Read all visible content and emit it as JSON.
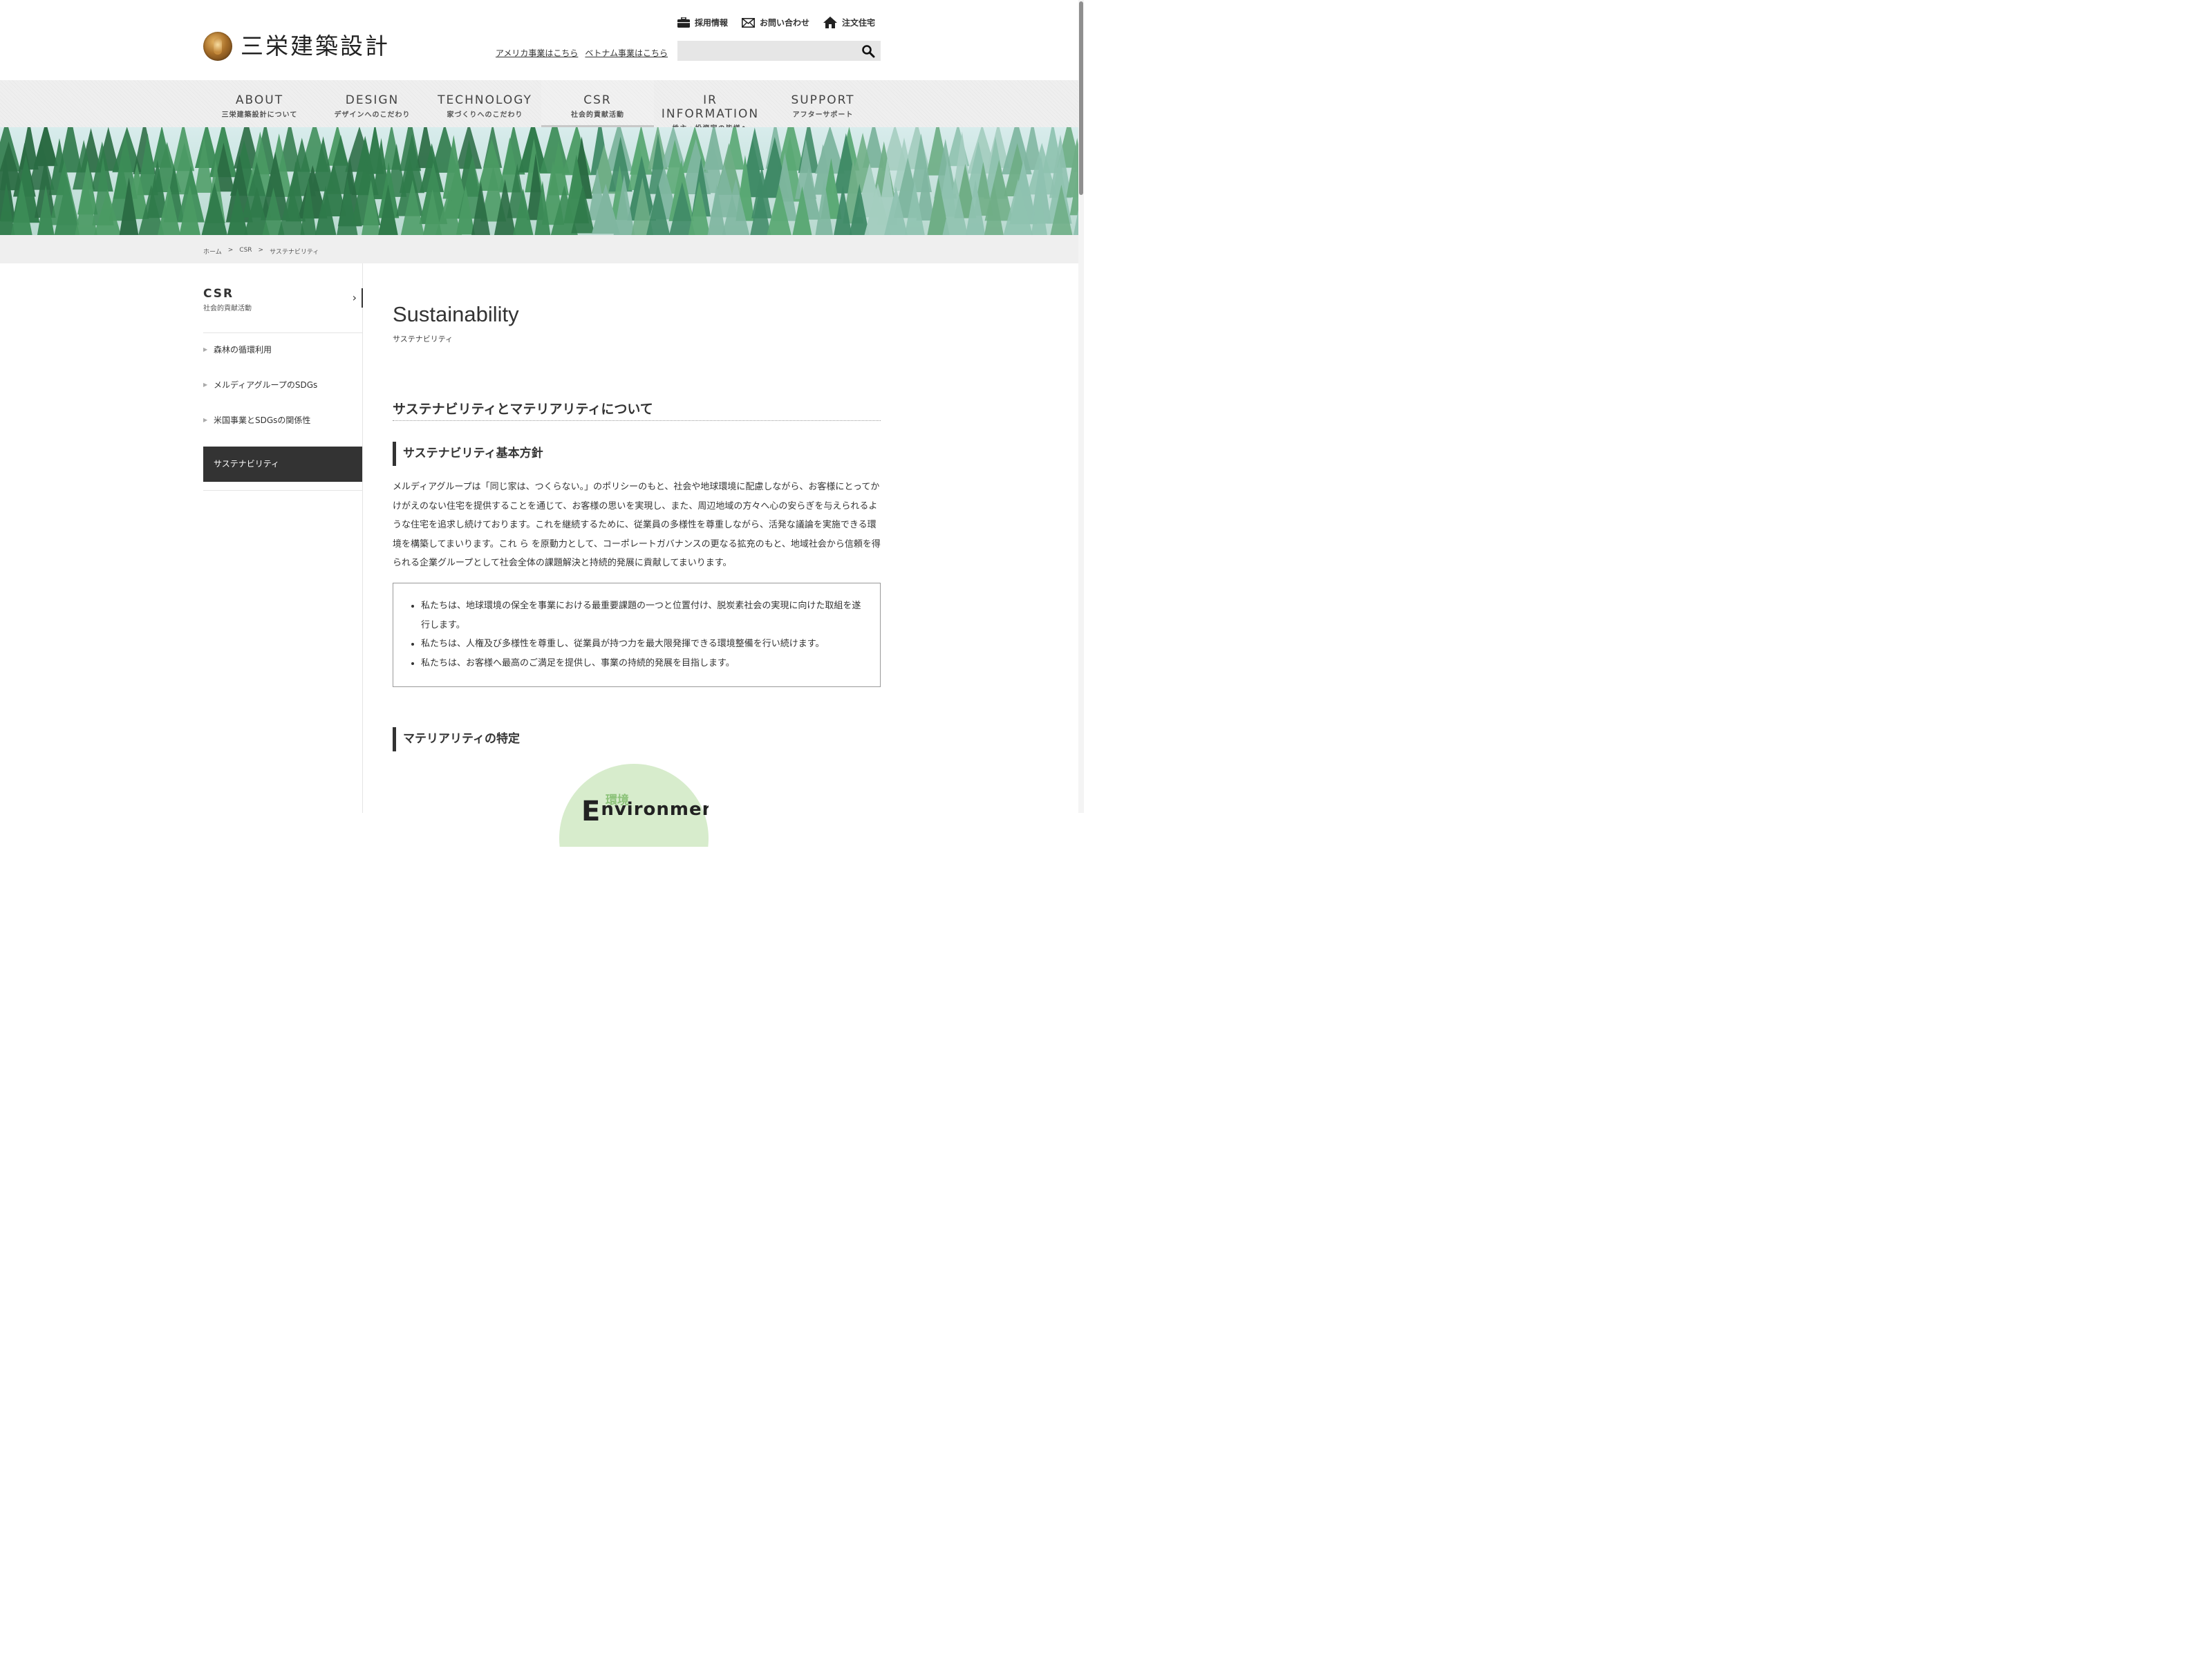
{
  "header": {
    "logo_text": "三栄建築設計",
    "util_links": [
      {
        "icon": "briefcase-icon",
        "label": "採用情報"
      },
      {
        "icon": "envelope-icon",
        "label": "お問い合わせ"
      },
      {
        "icon": "house-icon",
        "label": "注文住宅"
      }
    ],
    "sub_links": [
      "アメリカ事業はこちら",
      "ベトナム事業はこちら"
    ],
    "search": {
      "placeholder": "",
      "icon": "search-icon"
    }
  },
  "gnav": [
    {
      "en": "ABOUT",
      "ja": "三栄建築設計について",
      "active": false
    },
    {
      "en": "DESIGN",
      "ja": "デザインへのこだわり",
      "active": false
    },
    {
      "en": "TECHNOLOGY",
      "ja": "家づくりへのこだわり",
      "active": false
    },
    {
      "en": "CSR",
      "ja": "社会的貢献活動",
      "active": true
    },
    {
      "en": "IR INFORMATION",
      "ja": "株主・投資家の皆様へ",
      "active": false
    },
    {
      "en": "SUPPORT",
      "ja": "アフターサポート",
      "active": false
    }
  ],
  "breadcrumb": [
    "ホーム",
    ">",
    "CSR",
    ">",
    "サステナビリティ"
  ],
  "sidebar": {
    "title_en": "CSR",
    "title_ja": "社会的貢献活動",
    "items": [
      {
        "label": "森林の循環利用",
        "active": false
      },
      {
        "label": "メルディアグループのSDGs",
        "active": false
      },
      {
        "label": "米国事業とSDGsの関係性",
        "active": false
      },
      {
        "label": "サステナビリティ",
        "active": true
      }
    ]
  },
  "main": {
    "title": "Sustainability",
    "title_ja": "サステナビリティ",
    "h2": "サステナビリティとマテリアリティについて",
    "h3_policy": "サステナビリティ基本方針",
    "body": "メルディアグループは「同じ家は、つくらない。」のポリシーのもと、社会や地球環境に配慮しながら、お客様にとってかけがえのない住宅を提供することを通じて、お客様の思いを実現し、また、周辺地域の方々へ心の安らぎを与えられるような住宅を追求し続けております。これを継続するために、従業員の多様性を尊重しながら、活発な議論を実施できる環境を構築してまいります。これ ら を原動力として、コーポレートガバナンスの更なる拡充のもと、地域社会から信頼を得られる企業グループとして社会全体の課題解決と持続的発展に貢献してまいります。",
    "policies": [
      "私たちは、地球環境の保全を事業における最重要課題の一つと位置付け、脱炭素社会の実現に向けた取組を遂行します。",
      "私たちは、人権及び多様性を尊重し、従業員が持つ力を最大限発揮できる環境整備を行い続けます。",
      "私たちは、お客様へ最高のご満足を提供し、事業の持続的発展を目指します。"
    ],
    "h3_materiality": "マテリアリティの特定",
    "figure": {
      "ja": "環境",
      "en_initial": "E",
      "en_rest": "nvironment"
    }
  },
  "colors": {
    "nav_bg": "#efefef",
    "active_side_bg": "#333333",
    "env_circle": "#d7eccc",
    "env_ja": "#8dc37a"
  }
}
